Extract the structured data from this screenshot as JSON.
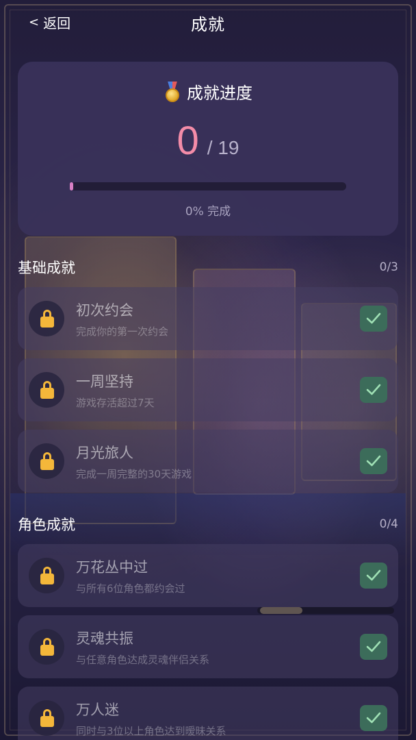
{
  "header": {
    "back_chevron": "<",
    "back_label": "返回",
    "title": "成就"
  },
  "progress": {
    "title": "成就进度",
    "medal_icon": "medal-icon",
    "current": "0",
    "total": "/ 19",
    "fraction": 0,
    "label": "0% 完成",
    "accent_color": "#f38ca8",
    "bar_color": "#d77fc4"
  },
  "sections": [
    {
      "title": "基础成就",
      "count": "0/3",
      "items": [
        {
          "name": "初次约会",
          "desc": "完成你的第一次约会",
          "locked": true
        },
        {
          "name": "一周坚持",
          "desc": "游戏存活超过7天",
          "locked": true
        },
        {
          "name": "月光旅人",
          "desc": "完成一周完整的30天游戏",
          "locked": true
        }
      ]
    },
    {
      "title": "角色成就",
      "count": "0/4",
      "items": [
        {
          "name": "万花丛中过",
          "desc": "与所有6位角色都约会过",
          "locked": true
        },
        {
          "name": "灵魂共振",
          "desc": "与任意角色达成灵魂伴侣关系",
          "locked": true
        },
        {
          "name": "万人迷",
          "desc": "同时与3位以上角色达到暧昧关系",
          "locked": true
        }
      ]
    }
  ],
  "colors": {
    "card_bg": "#3a325a",
    "check_bg": "#3c6c5a",
    "lock_color": "#f4b73a"
  }
}
